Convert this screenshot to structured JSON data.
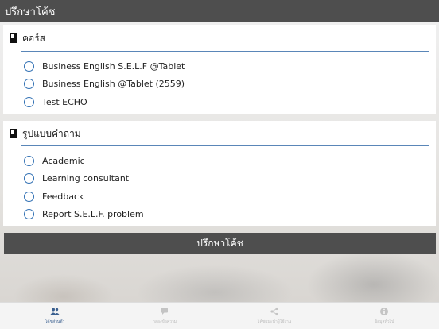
{
  "header": {
    "title": "ปรึกษาโค้ช"
  },
  "course_section": {
    "title": "คอร์ส",
    "options": [
      "Business English S.E.L.F @Tablet",
      "Business English @Tablet (2559)",
      "Test ECHO"
    ]
  },
  "question_section": {
    "title": "รูปแบบคำถาม",
    "options": [
      "Academic",
      "Learning consultant",
      "Feedback",
      "Report S.E.L.F. problem"
    ]
  },
  "submit_label": "ปรึกษาโค้ช",
  "tabs": [
    {
      "label": "โค้ชส่วนตัว",
      "icon": "people-icon",
      "active": true
    },
    {
      "label": "กล่องข้อความ",
      "icon": "chat-icon",
      "active": false
    },
    {
      "label": "โค้ชแนะนำผู้ใช้งาน",
      "icon": "share-icon",
      "active": false
    },
    {
      "label": "ข้อมูลทั่วไป",
      "icon": "info-icon",
      "active": false
    }
  ],
  "colors": {
    "header_bg": "#4e4e4e",
    "accent": "#2f6fb3",
    "active_tab": "#3a5f8f"
  }
}
